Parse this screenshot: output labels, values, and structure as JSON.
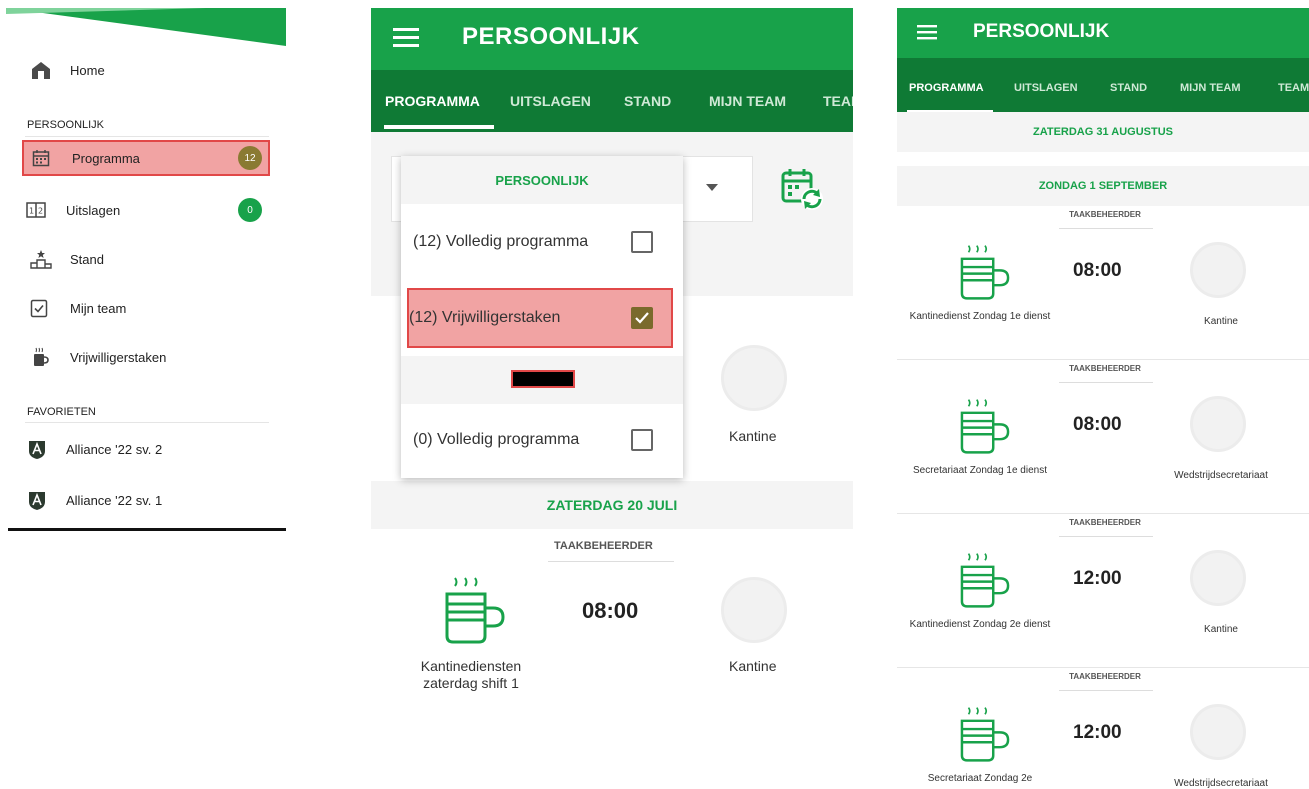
{
  "drawer": {
    "home_label": "Home",
    "section_personal": "PERSOONLIJK",
    "items": [
      {
        "label": "Programma",
        "badge": "12",
        "icon": "calendar-icon",
        "active": true,
        "badge_color": "#8a7a32"
      },
      {
        "label": "Uitslagen",
        "badge": "0",
        "icon": "scoreboard-icon",
        "active": false,
        "badge_color": "#18a24a"
      },
      {
        "label": "Stand",
        "icon": "podium-icon"
      },
      {
        "label": "Mijn team",
        "icon": "clipboard-check-icon"
      },
      {
        "label": "Vrijwilligerstaken",
        "icon": "volunteer-cup-icon"
      }
    ],
    "section_favorites": "FAVORIETEN",
    "favorites": [
      {
        "label": "Alliance '22  sv. 2",
        "icon": "club-logo-icon"
      },
      {
        "label": "Alliance '22  sv. 1",
        "icon": "club-logo-icon"
      }
    ]
  },
  "panel2": {
    "title": "PERSOONLIJK",
    "tabs": [
      "PROGRAMMA",
      "UITSLAGEN",
      "STAND",
      "MIJN TEAM",
      "TEAM"
    ],
    "active_tab": 0,
    "dropdown": {
      "header": "PERSOONLIJK",
      "options": [
        {
          "label": "(12)  Volledig programma",
          "checked": false
        },
        {
          "label": "(12)  Vrijwilligerstaken",
          "checked": true
        },
        {
          "label": "(0)  Volledig programma",
          "checked": false
        }
      ]
    },
    "behind_location": "Kantine",
    "date_header": "ZATERDAG 20 JULI",
    "card": {
      "role": "TAAKBEHEERDER",
      "time": "08:00",
      "task": "Kantinediensten zaterdag shift 1",
      "location": "Kantine"
    },
    "colors": {
      "primary": "#18a24a",
      "tabbar": "#0f7a35",
      "highlight": "#f1a3a3",
      "highlight_border": "#e14848"
    }
  },
  "panel3": {
    "title": "PERSOONLIJK",
    "tabs": [
      "PROGRAMMA",
      "UITSLAGEN",
      "STAND",
      "MIJN TEAM",
      "TEAM"
    ],
    "active_tab": 0,
    "date_header_1": "ZATERDAG 31 AUGUSTUS",
    "date_header_2": "ZONDAG 1 SEPTEMBER",
    "cards": [
      {
        "role": "TAAKBEHEERDER",
        "time": "08:00",
        "task": "Kantinedienst Zondag 1e dienst",
        "location": "Kantine"
      },
      {
        "role": "TAAKBEHEERDER",
        "time": "08:00",
        "task": "Secretariaat Zondag 1e dienst",
        "location": "Wedstrijdsecretariaat"
      },
      {
        "role": "TAAKBEHEERDER",
        "time": "12:00",
        "task": "Kantinedienst Zondag 2e dienst",
        "location": "Kantine"
      },
      {
        "role": "TAAKBEHEERDER",
        "time": "12:00",
        "task": "Secretariaat Zondag 2e",
        "location": "Wedstrijdsecretariaat"
      }
    ]
  }
}
